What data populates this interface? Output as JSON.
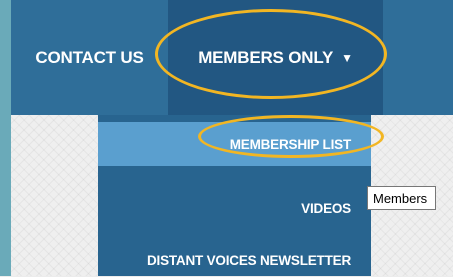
{
  "nav": {
    "contact_label": "CONTACT US",
    "members_label": "MEMBERS ONLY",
    "members_caret": "▼"
  },
  "dropdown": {
    "items": [
      {
        "label": "MEMBERSHIP LIST"
      },
      {
        "label": "VIDEOS"
      },
      {
        "label": "DISTANT VOICES NEWSLETTER"
      }
    ]
  },
  "tooltip": {
    "text": "Members"
  },
  "colors": {
    "nav_bg": "#2f6e99",
    "nav_active_bg": "#225782",
    "dropdown_bg": "#28648f",
    "dropdown_hover_bg": "#5a9fcf",
    "highlight": "#f2b623",
    "left_rail": "#6aaab9"
  }
}
